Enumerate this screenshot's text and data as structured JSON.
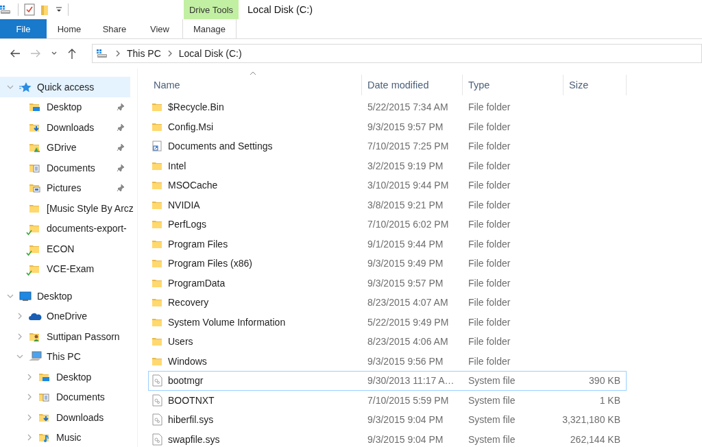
{
  "ribbon": {
    "context_group": "Drive Tools",
    "title": "Local Disk (C:)",
    "tabs": [
      {
        "label": "File",
        "kind": "file",
        "selected": false
      },
      {
        "label": "Home",
        "kind": "plain",
        "selected": false
      },
      {
        "label": "Share",
        "kind": "plain",
        "selected": false
      },
      {
        "label": "View",
        "kind": "plain",
        "selected": false
      },
      {
        "label": "Manage",
        "kind": "context",
        "selected": false
      }
    ]
  },
  "address": {
    "crumbs": [
      "This PC",
      "Local Disk (C:)"
    ]
  },
  "nav": [
    {
      "label": "Quick access",
      "kind": "star",
      "expanded": true,
      "selected": true,
      "children": [
        {
          "label": "Desktop",
          "kind": "desktop-folder",
          "pinned": true,
          "synced": false,
          "selected": false
        },
        {
          "label": "Downloads",
          "kind": "downloads-folder",
          "pinned": true,
          "synced": false,
          "selected": false
        },
        {
          "label": "GDrive",
          "kind": "gdrive-folder",
          "pinned": true,
          "synced": false,
          "selected": false
        },
        {
          "label": "Documents",
          "kind": "documents-folder",
          "pinned": true,
          "synced": false,
          "selected": false
        },
        {
          "label": "Pictures",
          "kind": "pictures-folder",
          "pinned": true,
          "synced": false,
          "selected": false
        },
        {
          "label": "[Music Style By Arcz",
          "kind": "folder",
          "pinned": false,
          "synced": false,
          "selected": false
        },
        {
          "label": "documents-export-",
          "kind": "folder",
          "pinned": false,
          "synced": true,
          "selected": false
        },
        {
          "label": "ECON",
          "kind": "folder",
          "pinned": false,
          "synced": true,
          "selected": false
        },
        {
          "label": "VCE-Exam",
          "kind": "folder",
          "pinned": false,
          "synced": true,
          "selected": false
        }
      ]
    },
    {
      "label": "Desktop",
      "kind": "monitor",
      "expanded": true,
      "selected": false,
      "children": [
        {
          "label": "OneDrive",
          "kind": "cloud",
          "expanded": false,
          "selected": false
        },
        {
          "label": "Suttipan Passorn",
          "kind": "user-folder",
          "expanded": false,
          "selected": false
        },
        {
          "label": "This PC",
          "kind": "computer",
          "expanded": true,
          "selected": false,
          "children": [
            {
              "label": "Desktop",
              "kind": "desktop-folder",
              "expanded": false,
              "selected": false
            },
            {
              "label": "Documents",
              "kind": "documents-folder",
              "expanded": false,
              "selected": false
            },
            {
              "label": "Downloads",
              "kind": "downloads-folder",
              "expanded": false,
              "selected": false
            },
            {
              "label": "Music",
              "kind": "music-folder",
              "expanded": false,
              "selected": false
            }
          ]
        }
      ]
    }
  ],
  "file_list": {
    "columns": [
      {
        "label": "Name",
        "sorted": true
      },
      {
        "label": "Date modified",
        "sorted": false
      },
      {
        "label": "Type",
        "sorted": false
      },
      {
        "label": "Size",
        "sorted": false
      }
    ],
    "rows": [
      {
        "name": "$Recycle.Bin",
        "date": "5/22/2015 7:34 AM",
        "type": "File folder",
        "kind": "folder",
        "selected": false
      },
      {
        "name": "Config.Msi",
        "date": "9/3/2015 9:57 PM",
        "type": "File folder",
        "kind": "folder",
        "selected": false
      },
      {
        "name": "Documents and Settings",
        "date": "7/10/2015 7:25 PM",
        "type": "File folder",
        "kind": "shortcut",
        "selected": false
      },
      {
        "name": "Intel",
        "date": "3/2/2015 9:19 PM",
        "type": "File folder",
        "kind": "folder",
        "selected": false
      },
      {
        "name": "MSOCache",
        "date": "3/10/2015 9:44 PM",
        "type": "File folder",
        "kind": "folder",
        "selected": false
      },
      {
        "name": "NVIDIA",
        "date": "3/8/2015 9:21 PM",
        "type": "File folder",
        "kind": "folder",
        "selected": false
      },
      {
        "name": "PerfLogs",
        "date": "7/10/2015 6:02 PM",
        "type": "File folder",
        "kind": "folder",
        "selected": false
      },
      {
        "name": "Program Files",
        "date": "9/1/2015 9:44 PM",
        "type": "File folder",
        "kind": "folder",
        "selected": false
      },
      {
        "name": "Program Files (x86)",
        "date": "9/3/2015 9:49 PM",
        "type": "File folder",
        "kind": "folder",
        "selected": false
      },
      {
        "name": "ProgramData",
        "date": "9/3/2015 9:57 PM",
        "type": "File folder",
        "kind": "folder",
        "selected": false
      },
      {
        "name": "Recovery",
        "date": "8/23/2015 4:07 AM",
        "type": "File folder",
        "kind": "folder",
        "selected": false
      },
      {
        "name": "System Volume Information",
        "date": "5/22/2015 9:49 PM",
        "type": "File folder",
        "kind": "folder",
        "selected": false
      },
      {
        "name": "Users",
        "date": "8/23/2015 4:06 AM",
        "type": "File folder",
        "kind": "folder",
        "selected": false
      },
      {
        "name": "Windows",
        "date": "9/3/2015 9:56 PM",
        "type": "File folder",
        "kind": "folder",
        "selected": false
      },
      {
        "name": "bootmgr",
        "date": "9/30/2013 11:17 A…",
        "type": "System file",
        "size": "390 KB",
        "kind": "system",
        "selected": true
      },
      {
        "name": "BOOTNXT",
        "date": "7/10/2015 5:59 PM",
        "type": "System file",
        "size": "1 KB",
        "kind": "system",
        "selected": false
      },
      {
        "name": "hiberfil.sys",
        "date": "9/3/2015 9:04 PM",
        "type": "System file",
        "size": "3,321,180 KB",
        "kind": "system",
        "selected": false
      },
      {
        "name": "swapfile.sys",
        "date": "9/3/2015 9:04 PM",
        "type": "System file",
        "size": "262,144 KB",
        "kind": "system",
        "selected": false
      }
    ]
  }
}
